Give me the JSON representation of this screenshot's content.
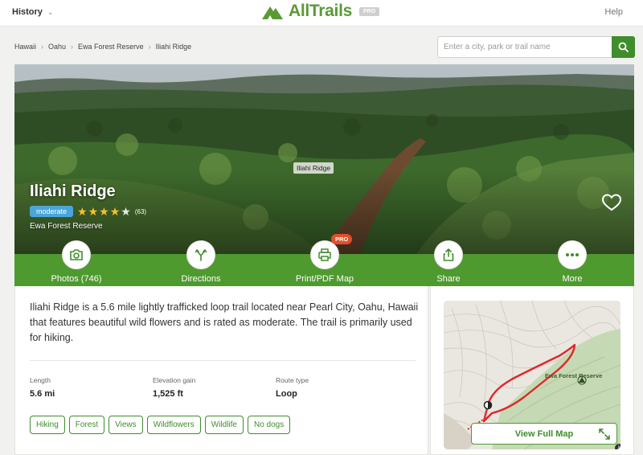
{
  "nav": {
    "history_label": "History",
    "brand": "AllTrails",
    "pro_badge": "PRO",
    "help_label": "Help"
  },
  "breadcrumb": [
    "Hawaii",
    "Oahu",
    "Ewa Forest Reserve",
    "Iliahi Ridge"
  ],
  "search": {
    "placeholder": "Enter a city, park or trail name",
    "value": ""
  },
  "hero": {
    "photo_caption": "Iliahi Ridge",
    "title": "Iliahi Ridge",
    "difficulty": "moderate",
    "rating_stars": 4.5,
    "rating_count": "(63)",
    "park": "Ewa Forest Reserve"
  },
  "actions": [
    {
      "label": "Photos (746)",
      "icon": "camera-icon"
    },
    {
      "label": "Directions",
      "icon": "directions-icon"
    },
    {
      "label": "Print/PDF Map",
      "icon": "print-icon",
      "badge": "PRO"
    },
    {
      "label": "Share",
      "icon": "share-icon"
    },
    {
      "label": "More",
      "icon": "more-icon"
    }
  ],
  "description": "Iliahi Ridge is a 5.6 mile lightly trafficked loop trail located near Pearl City, Oahu, Hawaii that features beautiful wild flowers and is rated as moderate. The trail is primarily used for hiking.",
  "stats": [
    {
      "label": "Length",
      "value": "5.6 mi"
    },
    {
      "label": "Elevation gain",
      "value": "1,525 ft"
    },
    {
      "label": "Route type",
      "value": "Loop"
    }
  ],
  "tags": [
    "Hiking",
    "Forest",
    "Views",
    "Wildflowers",
    "Wildlife",
    "No dogs"
  ],
  "map": {
    "label": "Ewa Forest Reserve",
    "button": "View Full Map",
    "info": "i"
  },
  "colors": {
    "brand_green": "#3f8d2c",
    "bar_green": "#4e9a2f",
    "difficulty_blue": "#4aa6da",
    "pro_orange": "#e24f2b",
    "star": "#f7c02c",
    "route_red": "#e0262a"
  }
}
